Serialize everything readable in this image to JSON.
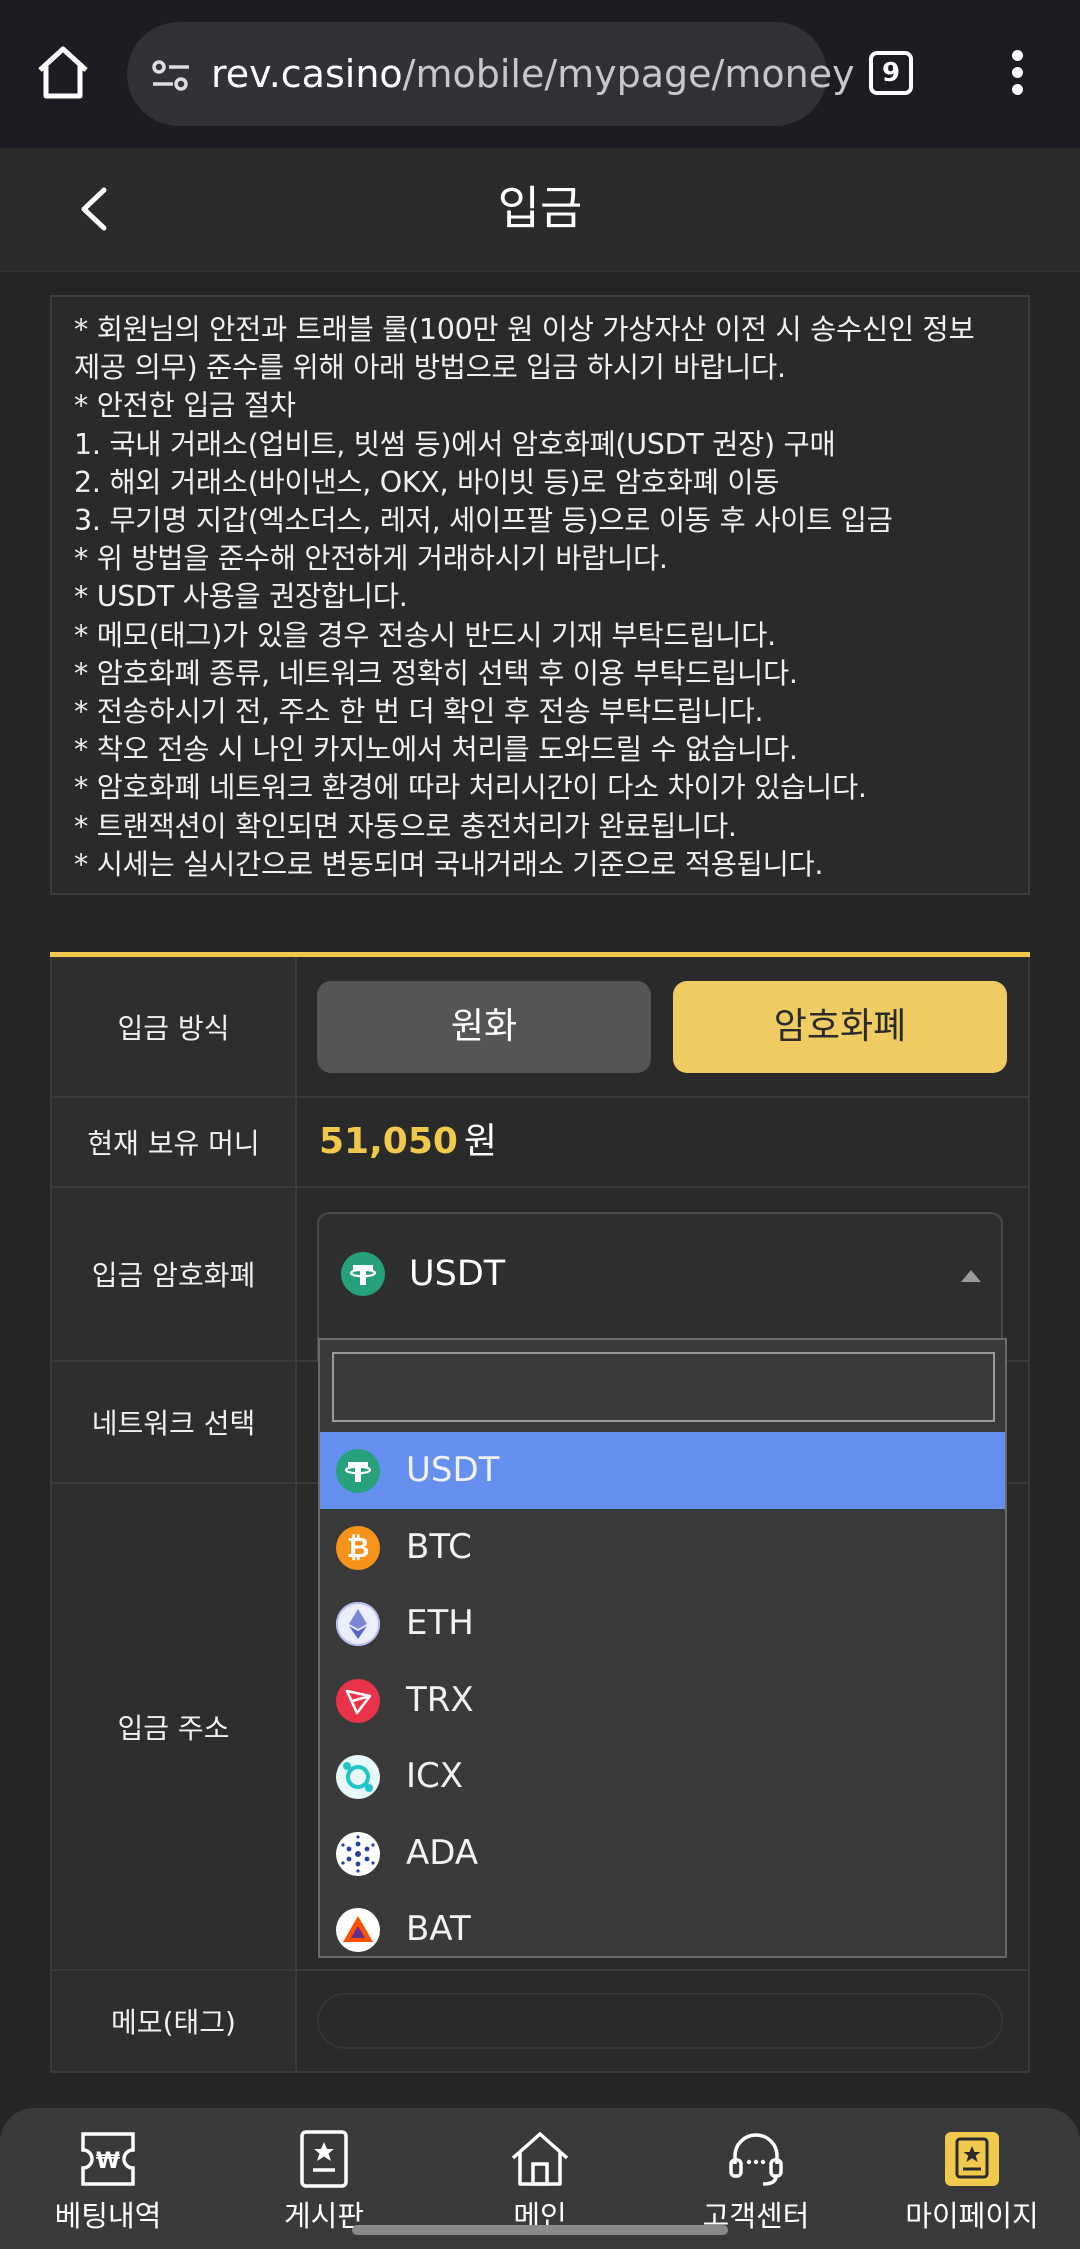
{
  "browser": {
    "url_host": "rev.casino",
    "url_path": "/mobile/mypage/money",
    "tab_count": "9"
  },
  "header": {
    "title": "입금"
  },
  "notice": {
    "lines": [
      "* 회원님의 안전과 트래블 룰(100만 원 이상 가상자산 이전 시 송수신인 정보",
      "제공 의무) 준수를 위해 아래 방법으로 입금 하시기 바랍니다.",
      "* 안전한 입금 절차",
      "1. 국내 거래소(업비트, 빗썸 등)에서 암호화폐(USDT 권장) 구매",
      "2. 해외 거래소(바이낸스, OKX, 바이빗 등)로 암호화폐 이동",
      "3. 무기명 지갑(엑소더스, 레저, 세이프팔 등)으로 이동 후 사이트 입금",
      "* 위 방법을 준수해 안전하게 거래하시기 바랍니다.",
      "* USDT 사용을 권장합니다.",
      "* 메모(태그)가 있을 경우 전송시 반드시 기재 부탁드립니다.",
      "* 암호화폐 종류, 네트워크 정확히 선택 후 이용 부탁드립니다.",
      "* 전송하시기 전, 주소 한 번 더 확인 후 전송 부탁드립니다.",
      "* 착오 전송 시 나인 카지노에서 처리를 도와드릴 수 없습니다.",
      "* 암호화폐 네트워크 환경에 따라 처리시간이 다소 차이가 있습니다.",
      "* 트랜잭션이 확인되면 자동으로 충전처리가 완료됩니다.",
      "* 시세는 실시간으로 변동되며 국내거래소 기준으로 적용됩니다."
    ]
  },
  "form": {
    "method_label": "입금 방식",
    "method_options": [
      "원화",
      "암호화폐"
    ],
    "method_selected": "암호화폐",
    "balance_label": "현재 보유 머니",
    "balance_amount": "51,050",
    "balance_unit": "원",
    "coin_label": "입금 암호화폐",
    "coin_selected": "USDT",
    "network_label": "네트워크 선택",
    "address_label": "입금 주소",
    "memo_label": "메모(태그)",
    "memo_value": ""
  },
  "dropdown": {
    "search_value": "",
    "items": [
      {
        "label": "USDT",
        "icon": "usdt-icon",
        "color": "#26a17b",
        "glyph": "₮",
        "selected": true
      },
      {
        "label": "BTC",
        "icon": "btc-icon",
        "color": "#f7931a",
        "glyph": "₿",
        "selected": false
      },
      {
        "label": "ETH",
        "icon": "eth-icon",
        "color": "#8a92b2",
        "glyph": "◆",
        "selected": false
      },
      {
        "label": "TRX",
        "icon": "trx-icon",
        "color": "#e9334b",
        "glyph": "▶",
        "selected": false
      },
      {
        "label": "ICX",
        "icon": "icx-icon",
        "color": "#1fc5c9",
        "glyph": "◎",
        "selected": false
      },
      {
        "label": "ADA",
        "icon": "ada-icon",
        "color": "#2a3ea8",
        "glyph": "✺",
        "selected": false
      },
      {
        "label": "BAT",
        "icon": "bat-icon",
        "color": "#ff5000",
        "glyph": "▲",
        "selected": false
      }
    ]
  },
  "bottom_nav": [
    {
      "label": "베팅내역",
      "icon": "betting-ticket-icon"
    },
    {
      "label": "게시판",
      "icon": "board-icon"
    },
    {
      "label": "메인",
      "icon": "home-icon"
    },
    {
      "label": "고객센터",
      "icon": "headset-icon"
    },
    {
      "label": "마이페이지",
      "icon": "mypage-icon",
      "active": true
    }
  ],
  "colors": {
    "accent": "#f0c94c",
    "selected_row": "#6690f0",
    "background": "#262626"
  }
}
